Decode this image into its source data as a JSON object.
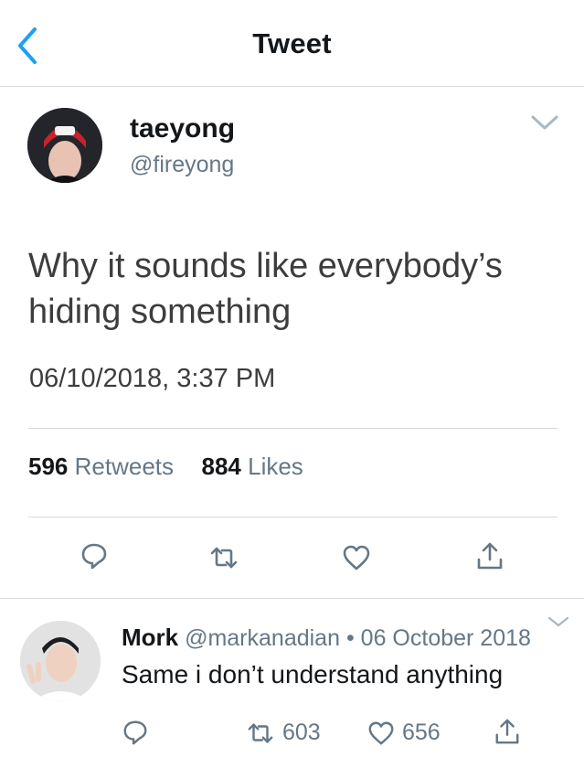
{
  "header": {
    "title": "Tweet"
  },
  "tweet": {
    "display_name": "taeyong",
    "handle": "@fireyong",
    "text": "Why it sounds like everybody’s hiding something",
    "timestamp": "06/10/2018, 3:37 PM",
    "retweets_count": "596",
    "retweets_label": "Retweets",
    "likes_count": "884",
    "likes_label": "Likes"
  },
  "reply": {
    "display_name": "Mork",
    "handle": "@markanadian",
    "separator": "•",
    "date": "06 October 2018",
    "text": "Same i don’t understand anything",
    "retweets_count": "603",
    "likes_count": "656"
  },
  "icons": [
    "back-icon",
    "chevron-down-icon",
    "reply-icon",
    "retweet-icon",
    "like-icon",
    "share-icon"
  ],
  "colors": {
    "accent": "#1da1f2",
    "icon_gray": "#657786",
    "divider": "#d5d9dc"
  }
}
